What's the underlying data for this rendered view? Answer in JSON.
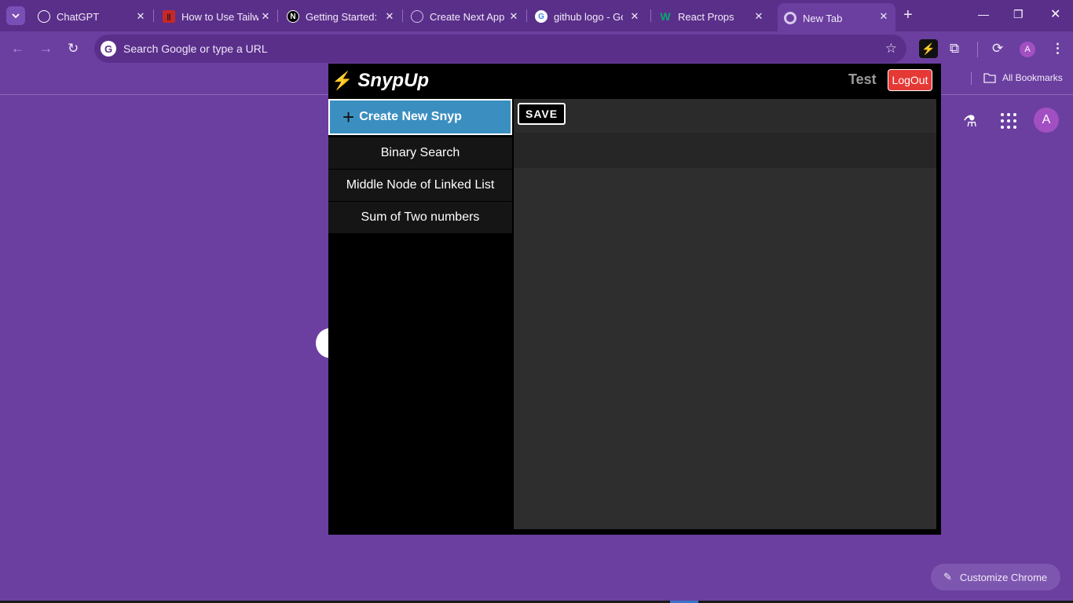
{
  "browser": {
    "tabs": [
      {
        "title": "ChatGPT",
        "favicon": "chatgpt-icon",
        "active": false
      },
      {
        "title": "How to Use Tailw",
        "favicon": "video-icon",
        "active": false
      },
      {
        "title": "Getting Started:",
        "favicon": "nextjs-icon",
        "active": false
      },
      {
        "title": "Create Next App",
        "favicon": "globe-icon",
        "active": false
      },
      {
        "title": "github logo - Go",
        "favicon": "google-icon",
        "active": false
      },
      {
        "title": "React Props",
        "favicon": "w3schools-icon",
        "active": false
      },
      {
        "title": "New Tab",
        "favicon": "chrome-icon",
        "active": true
      }
    ],
    "omnibox": {
      "placeholder": "Search Google or type a URL"
    },
    "bookmarks": {
      "all_bookmarks_label": "All Bookmarks"
    },
    "profile_initial": "A",
    "customize_label": "Customize Chrome",
    "theme_color": "#6b3fa0"
  },
  "extension": {
    "brand": "SnypUp",
    "username": "Test",
    "logout_label": "LogOut",
    "create_label": "Create New Snyp",
    "save_label": "SAVE",
    "snyps": [
      "Binary Search",
      "Middle Node of Linked List",
      "Sum of Two numbers"
    ],
    "accent_color": "#3b8fc0",
    "logout_color": "#e53935"
  }
}
